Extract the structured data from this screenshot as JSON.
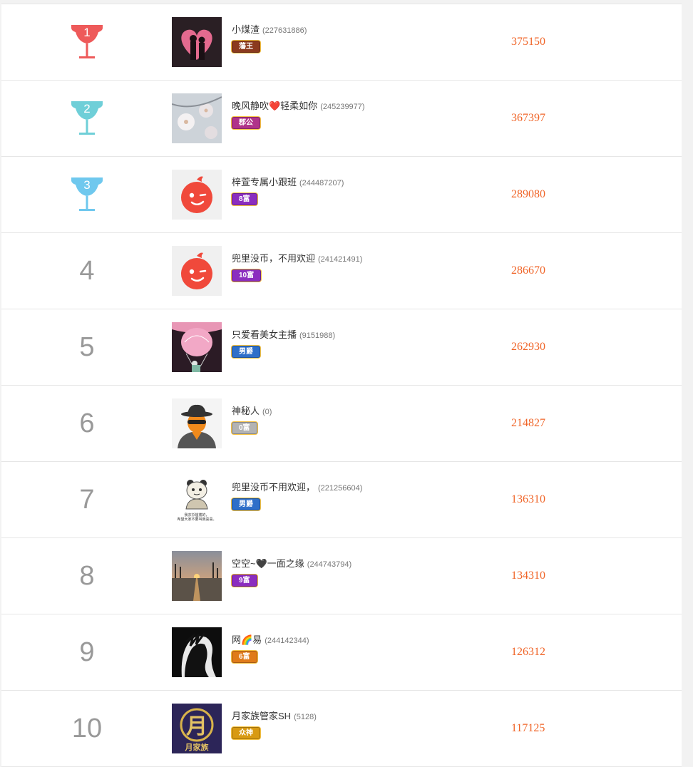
{
  "accent_colors": {
    "score": "#f06427",
    "gold": "#f5c243",
    "trophy_first": "#ee5a5a",
    "trophy_second": "#6fcfd8",
    "trophy_third": "#6fc8ee"
  },
  "rows": [
    {
      "rank": "1",
      "trophy": true,
      "trophy_color": "#ee5a5a",
      "avatar": "couple-heart-avatar",
      "name": "小煤渣",
      "uid": "(227631886)",
      "badge": "藩王",
      "badge_color": "#8b3a1e",
      "score": "375150"
    },
    {
      "rank": "2",
      "trophy": true,
      "trophy_color": "#6fcfd8",
      "avatar": "blossom-avatar",
      "name": "晚风静吹❤️轻柔如你",
      "uid": "(245239977)",
      "badge": "郡公",
      "badge_color": "#b0338a",
      "score": "367397"
    },
    {
      "rank": "3",
      "trophy": true,
      "trophy_color": "#6fc8ee",
      "avatar": "default-face-avatar",
      "name": "梓萱专属小跟班",
      "uid": "(244487207)",
      "badge": "8富",
      "badge_color": "#8b2dbf",
      "score": "289080"
    },
    {
      "rank": "4",
      "trophy": false,
      "avatar": "default-face-avatar",
      "name": "兜里没币，不用欢迎",
      "uid": "(241421491)",
      "badge": "10富",
      "badge_color": "#8b2dbf",
      "score": "286670"
    },
    {
      "rank": "5",
      "trophy": false,
      "avatar": "balloon-avatar",
      "name": "只爱看美女主播",
      "uid": "(9151988)",
      "badge": "男爵",
      "badge_color": "#2e6fc9",
      "score": "262930"
    },
    {
      "rank": "6",
      "trophy": false,
      "avatar": "mystery-man-avatar",
      "name": "神秘人",
      "uid": "(0)",
      "badge": "0富",
      "badge_color": "#b3b3b3",
      "score": "214827"
    },
    {
      "rank": "7",
      "trophy": false,
      "avatar": "panda-meme-avatar",
      "name": "兜里没币不用欢迎，",
      "uid": "(221256604)",
      "badge": "男爵",
      "badge_color": "#2e6fc9",
      "score": "136310"
    },
    {
      "rank": "8",
      "trophy": false,
      "avatar": "sunset-avatar",
      "name": "空空~🖤一面之缘",
      "uid": "(244743794)",
      "badge": "9富",
      "badge_color": "#8b2dbf",
      "score": "134310"
    },
    {
      "rank": "9",
      "trophy": false,
      "avatar": "dark-silhouette-avatar",
      "name": "网🌈易",
      "uid": "(244142344)",
      "badge": "6富",
      "badge_color": "#e07b1a",
      "score": "126312"
    },
    {
      "rank": "10",
      "trophy": false,
      "avatar": "moon-family-avatar",
      "name": "月家族管家SH",
      "uid": "(5128)",
      "badge": "众神",
      "badge_color": "#d89a12",
      "score": "117125"
    }
  ],
  "avatar_texts": {
    "panda_caption": "我衣衫褴褛的，希望大家不要叫我喜喜。",
    "moon_family_label": "月家族",
    "moon_family_glyph": "月"
  }
}
